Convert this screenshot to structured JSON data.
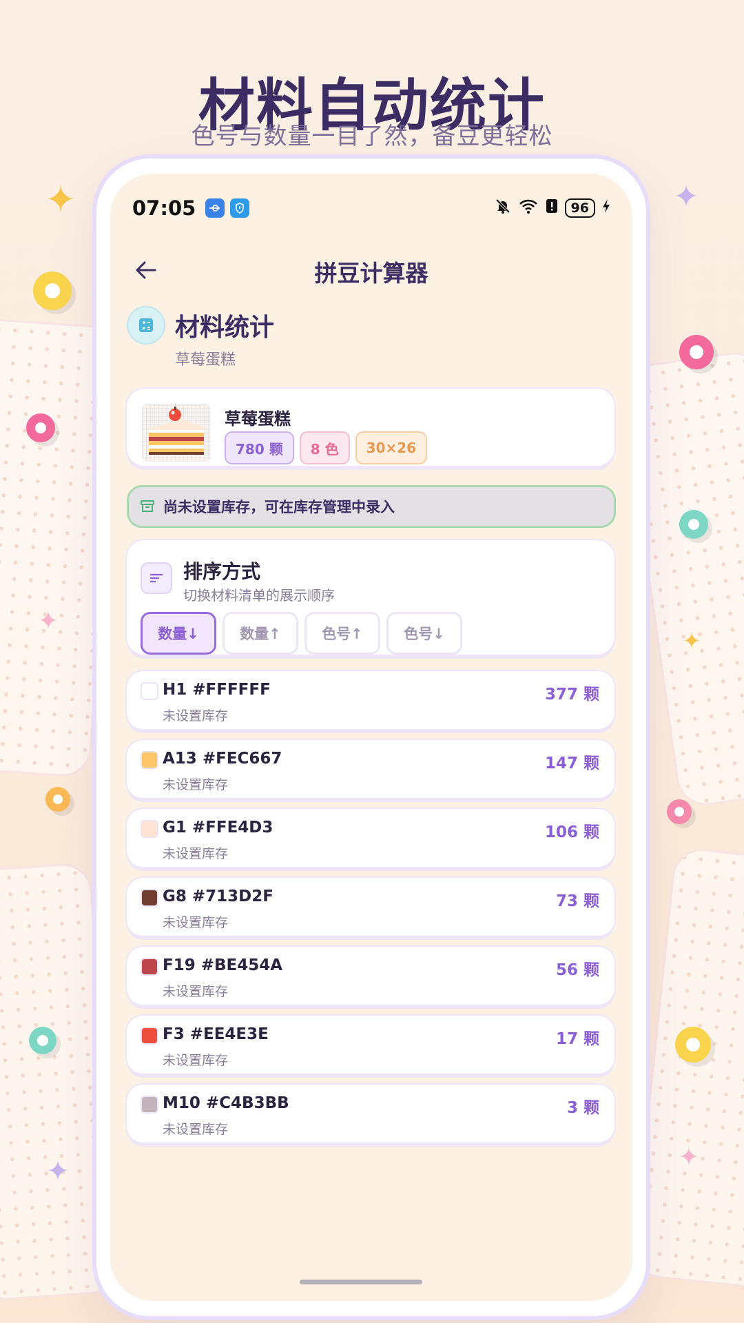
{
  "banner": {
    "title": "材料自动统计",
    "subtitle": "色号与数量一目了然，备豆更轻松"
  },
  "status_bar": {
    "time": "07:05",
    "battery": "96",
    "left_icons": [
      "usb-icon",
      "shield-icon"
    ],
    "right_icons": [
      "mute-bell-icon",
      "wifi-icon",
      "alert-icon",
      "battery-icon",
      "charging-icon"
    ]
  },
  "app_bar": {
    "title": "拼豆计算器"
  },
  "header": {
    "title": "材料统计",
    "subtitle": "草莓蛋糕"
  },
  "pattern": {
    "name": "草莓蛋糕",
    "bead_count": "780 颗",
    "color_count": "8 色",
    "size": "30×26"
  },
  "notice": {
    "text": "尚未设置库存，可在库存管理中录入"
  },
  "sort": {
    "title": "排序方式",
    "subtitle": "切换材料清单的展示顺序",
    "options": [
      {
        "label": "数量↓",
        "active": true
      },
      {
        "label": "数量↑",
        "active": false
      },
      {
        "label": "色号↑",
        "active": false
      },
      {
        "label": "色号↓",
        "active": false
      }
    ]
  },
  "colors": [
    {
      "name": "H1 #FFFFFF",
      "swatch": "#FFFFFF",
      "stock": "未设置库存",
      "count": "377 颗"
    },
    {
      "name": "A13 #FEC667",
      "swatch": "#FEC667",
      "stock": "未设置库存",
      "count": "147 颗"
    },
    {
      "name": "G1 #FFE4D3",
      "swatch": "#FFE4D3",
      "stock": "未设置库存",
      "count": "106 颗"
    },
    {
      "name": "G8 #713D2F",
      "swatch": "#713D2F",
      "stock": "未设置库存",
      "count": "73 颗"
    },
    {
      "name": "F19 #BE454A",
      "swatch": "#BE454A",
      "stock": "未设置库存",
      "count": "56 颗"
    },
    {
      "name": "F3 #EE4E3E",
      "swatch": "#EE4E3E",
      "stock": "未设置库存",
      "count": "17 颗"
    },
    {
      "name": "M10 #C4B3BB",
      "swatch": "#C4B3BB",
      "stock": "未设置库存",
      "count": "3 颗"
    }
  ],
  "theme": {
    "accent": "#8B5FD5",
    "title_color": "#3B2D63",
    "notice_border": "#A9D9AE"
  }
}
